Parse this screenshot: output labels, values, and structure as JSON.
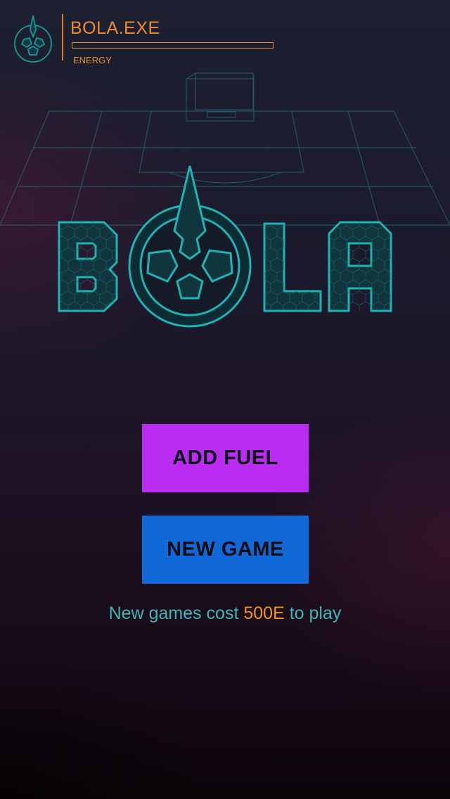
{
  "hud": {
    "title": "BOLA.EXE",
    "energy_label": "ENERGY",
    "energy_level": 0.0,
    "accent_color": "#f08a2c"
  },
  "logo": {
    "wordmark": "BOLA",
    "color": "#1fb3b3"
  },
  "buttons": {
    "add_fuel": {
      "label": "ADD FUEL",
      "color": "#bb2cf2"
    },
    "new_game": {
      "label": "NEW GAME",
      "color": "#1169d8"
    }
  },
  "cost_note": {
    "prefix": "New games cost",
    "amount": "500E",
    "suffix": "to play"
  },
  "icons": [
    "bola-emblem-icon",
    "soccer-field-background"
  ]
}
